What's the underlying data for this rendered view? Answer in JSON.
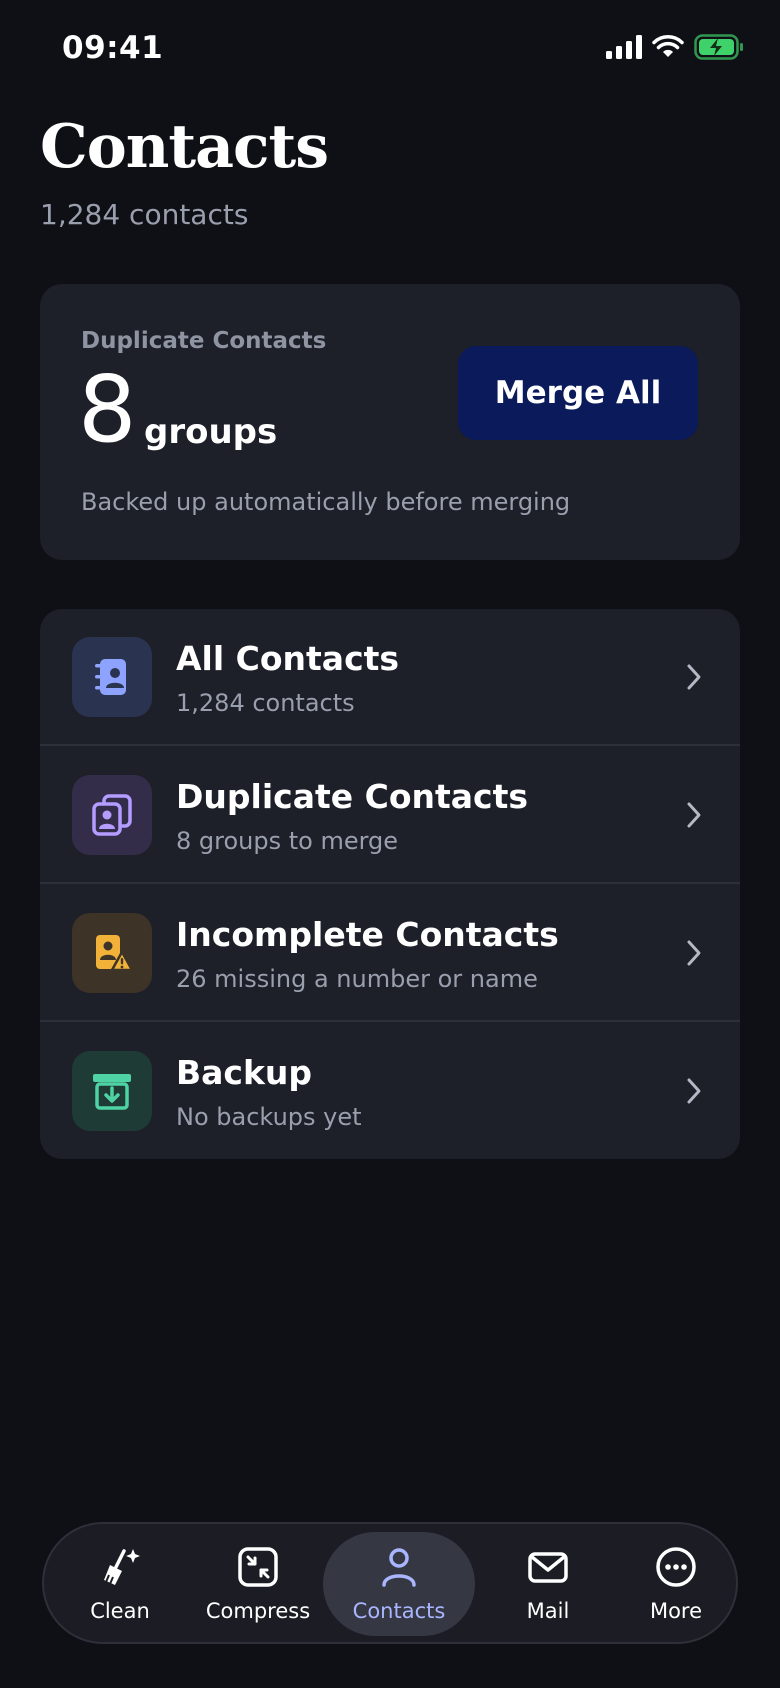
{
  "status_bar": {
    "time": "09:41",
    "icons": [
      "cellular-signal-icon",
      "wifi-icon",
      "battery-charging-icon"
    ]
  },
  "header": {
    "title": "Contacts",
    "subtitle": "1,284 contacts"
  },
  "summary": {
    "label": "Duplicate Contacts",
    "count": "8",
    "unit": "groups",
    "note": "Backed up automatically before merging",
    "merge_button": "Merge All"
  },
  "list": {
    "items": [
      {
        "title": "All Contacts",
        "subtitle": "1,284 contacts",
        "icon": "address-book-icon",
        "accent": "#8ea2ff"
      },
      {
        "title": "Duplicate Contacts",
        "subtitle": "8 groups to merge",
        "icon": "duplicate-contact-icon",
        "accent": "#b59cff"
      },
      {
        "title": "Incomplete Contacts",
        "subtitle": "26 missing a number or name",
        "icon": "incomplete-contact-icon",
        "accent": "#f2b23a"
      },
      {
        "title": "Backup",
        "subtitle": "No backups yet",
        "icon": "archive-download-icon",
        "accent": "#4fd3a5"
      }
    ]
  },
  "tab_bar": {
    "tabs": [
      {
        "label": "Clean",
        "icon": "broom-sparkle-icon",
        "active": false
      },
      {
        "label": "Compress",
        "icon": "compress-icon",
        "active": false
      },
      {
        "label": "Contacts",
        "icon": "person-icon",
        "active": true
      },
      {
        "label": "Mail",
        "icon": "envelope-icon",
        "active": false
      },
      {
        "label": "More",
        "icon": "ellipsis-circle-icon",
        "active": false
      }
    ]
  },
  "colors": {
    "background": "#0f1015",
    "card": "#1d1f29",
    "merge_button": "#0b1a5a",
    "active_tab": "#a9b6ff",
    "battery": "#3fd26a"
  }
}
